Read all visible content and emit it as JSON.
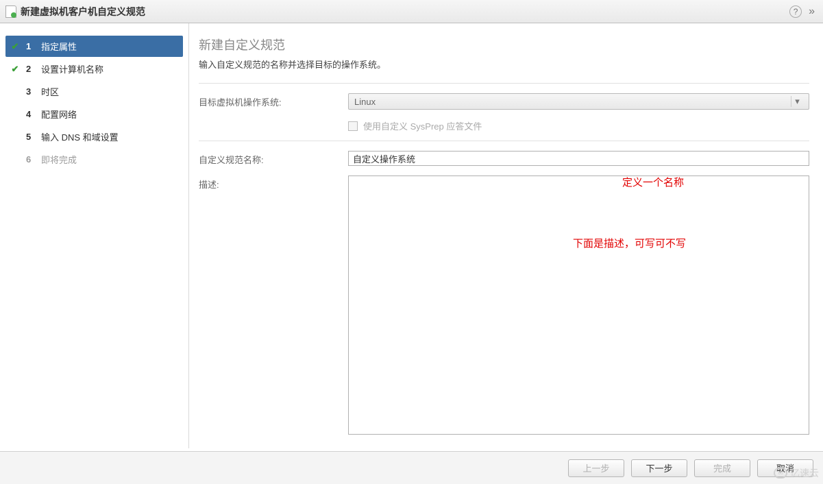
{
  "titlebar": {
    "title": "新建虚拟机客户机自定义规范"
  },
  "sidebar": {
    "steps": [
      {
        "num": "1",
        "label": "指定属性",
        "state": "active",
        "checked": true
      },
      {
        "num": "2",
        "label": "设置计算机名称",
        "state": "normal",
        "checked": true
      },
      {
        "num": "3",
        "label": "时区",
        "state": "normal",
        "checked": false
      },
      {
        "num": "4",
        "label": "配置网络",
        "state": "normal",
        "checked": false
      },
      {
        "num": "5",
        "label": "输入 DNS 和域设置",
        "state": "normal",
        "checked": false
      },
      {
        "num": "6",
        "label": "即将完成",
        "state": "disabled",
        "checked": false
      }
    ]
  },
  "main": {
    "heading": "新建自定义规范",
    "subtitle": "输入自定义规范的名称并选择目标的操作系统。",
    "os_label": "目标虚拟机操作系统:",
    "os_value": "Linux",
    "sysprep_label": "使用自定义 SysPrep 应答文件",
    "name_label": "自定义规范名称:",
    "name_value": "自定义操作系统",
    "desc_label": "描述:"
  },
  "annotations": {
    "a1": "定义一个名称",
    "a2": "下面是描述，可写可不写"
  },
  "footer": {
    "back": "上一步",
    "next": "下一步",
    "finish": "完成",
    "cancel": "取消"
  },
  "watermark": {
    "text": "亿速云"
  }
}
